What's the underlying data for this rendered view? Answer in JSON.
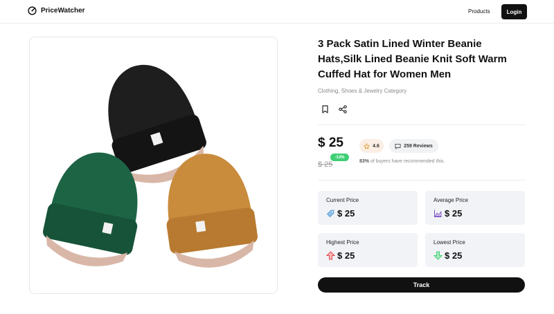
{
  "header": {
    "brand": "PriceWatcher",
    "nav_products": "Products",
    "login_label": "Login"
  },
  "product": {
    "title": "3 Pack Satin Lined Winter Beanie Hats,Silk Lined Beanie Knit Soft Warm Cuffed Hat for Women Men",
    "category": "Clothing, Shoes & Jewelry Category",
    "price": "$ 25",
    "old_price": "$ 25",
    "discount": "-13%",
    "rating": "4.6",
    "reviews": "259 Reviews",
    "recommend_pct": "83%",
    "recommend_text": " of buyers have recommended this.",
    "image_colors": [
      "#1b1b1b",
      "#1a5e3f",
      "#c98b3c"
    ]
  },
  "stats": {
    "current": {
      "label": "Current Price",
      "value": "$ 25",
      "icon": "price-tag-icon"
    },
    "average": {
      "label": "Average Price",
      "value": "$ 25",
      "icon": "area-chart-icon"
    },
    "highest": {
      "label": "Highest Price",
      "value": "$ 25",
      "icon": "arrow-up-icon"
    },
    "lowest": {
      "label": "Lowest Price",
      "value": "$ 25",
      "icon": "arrow-down-icon"
    }
  },
  "track_label": "Track",
  "colors": {
    "accent": "#111111",
    "discount": "#3ecf74",
    "up": "#e5484d",
    "down": "#3ecf74",
    "card_bg": "#f1f3f6"
  }
}
